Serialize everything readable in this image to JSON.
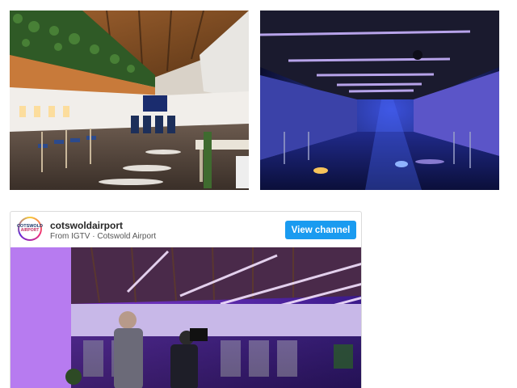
{
  "photos": {
    "left": {
      "icon": "photo-airplane-interior-lounge"
    },
    "right": {
      "icon": "photo-airplane-interior-blue-lights"
    }
  },
  "embed": {
    "avatar_text_line1": "COTSWOLD",
    "avatar_text_line2": "AIRPORT",
    "account_name": "cotswoldairport",
    "source_prefix": "From IGTV",
    "separator": " · ",
    "source_account": "Cotswold Airport",
    "view_button_label": "View channel",
    "accent_color": "#1a9bf0",
    "media": {
      "icon": "photo-event-purple-lighting"
    }
  }
}
